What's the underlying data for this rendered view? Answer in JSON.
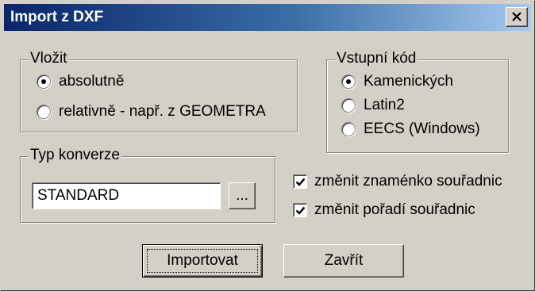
{
  "window": {
    "title": "Import z DXF"
  },
  "insert_group": {
    "legend": "Vložit",
    "options": [
      {
        "label": "absolutně",
        "selected": true
      },
      {
        "label": "relativně - např. z GEOMETRA",
        "selected": false
      }
    ]
  },
  "encoding_group": {
    "legend": "Vstupní kód",
    "options": [
      {
        "label": "Kamenických",
        "selected": true
      },
      {
        "label": "Latin2",
        "selected": false
      },
      {
        "label": "EECS (Windows)",
        "selected": false
      }
    ]
  },
  "conversion_group": {
    "legend": "Typ konverze",
    "value": "STANDARD",
    "browse_label": "..."
  },
  "checkboxes": [
    {
      "label": "změnit znaménko souřadnic",
      "checked": true
    },
    {
      "label": "změnit pořadí souřadnic",
      "checked": true
    }
  ],
  "buttons": {
    "import_label": "Importovat",
    "close_label": "Zavřít"
  },
  "colors": {
    "face": "#d4d0c8",
    "title_gradient_start": "#0a246a",
    "title_gradient_end": "#a6caf0"
  }
}
